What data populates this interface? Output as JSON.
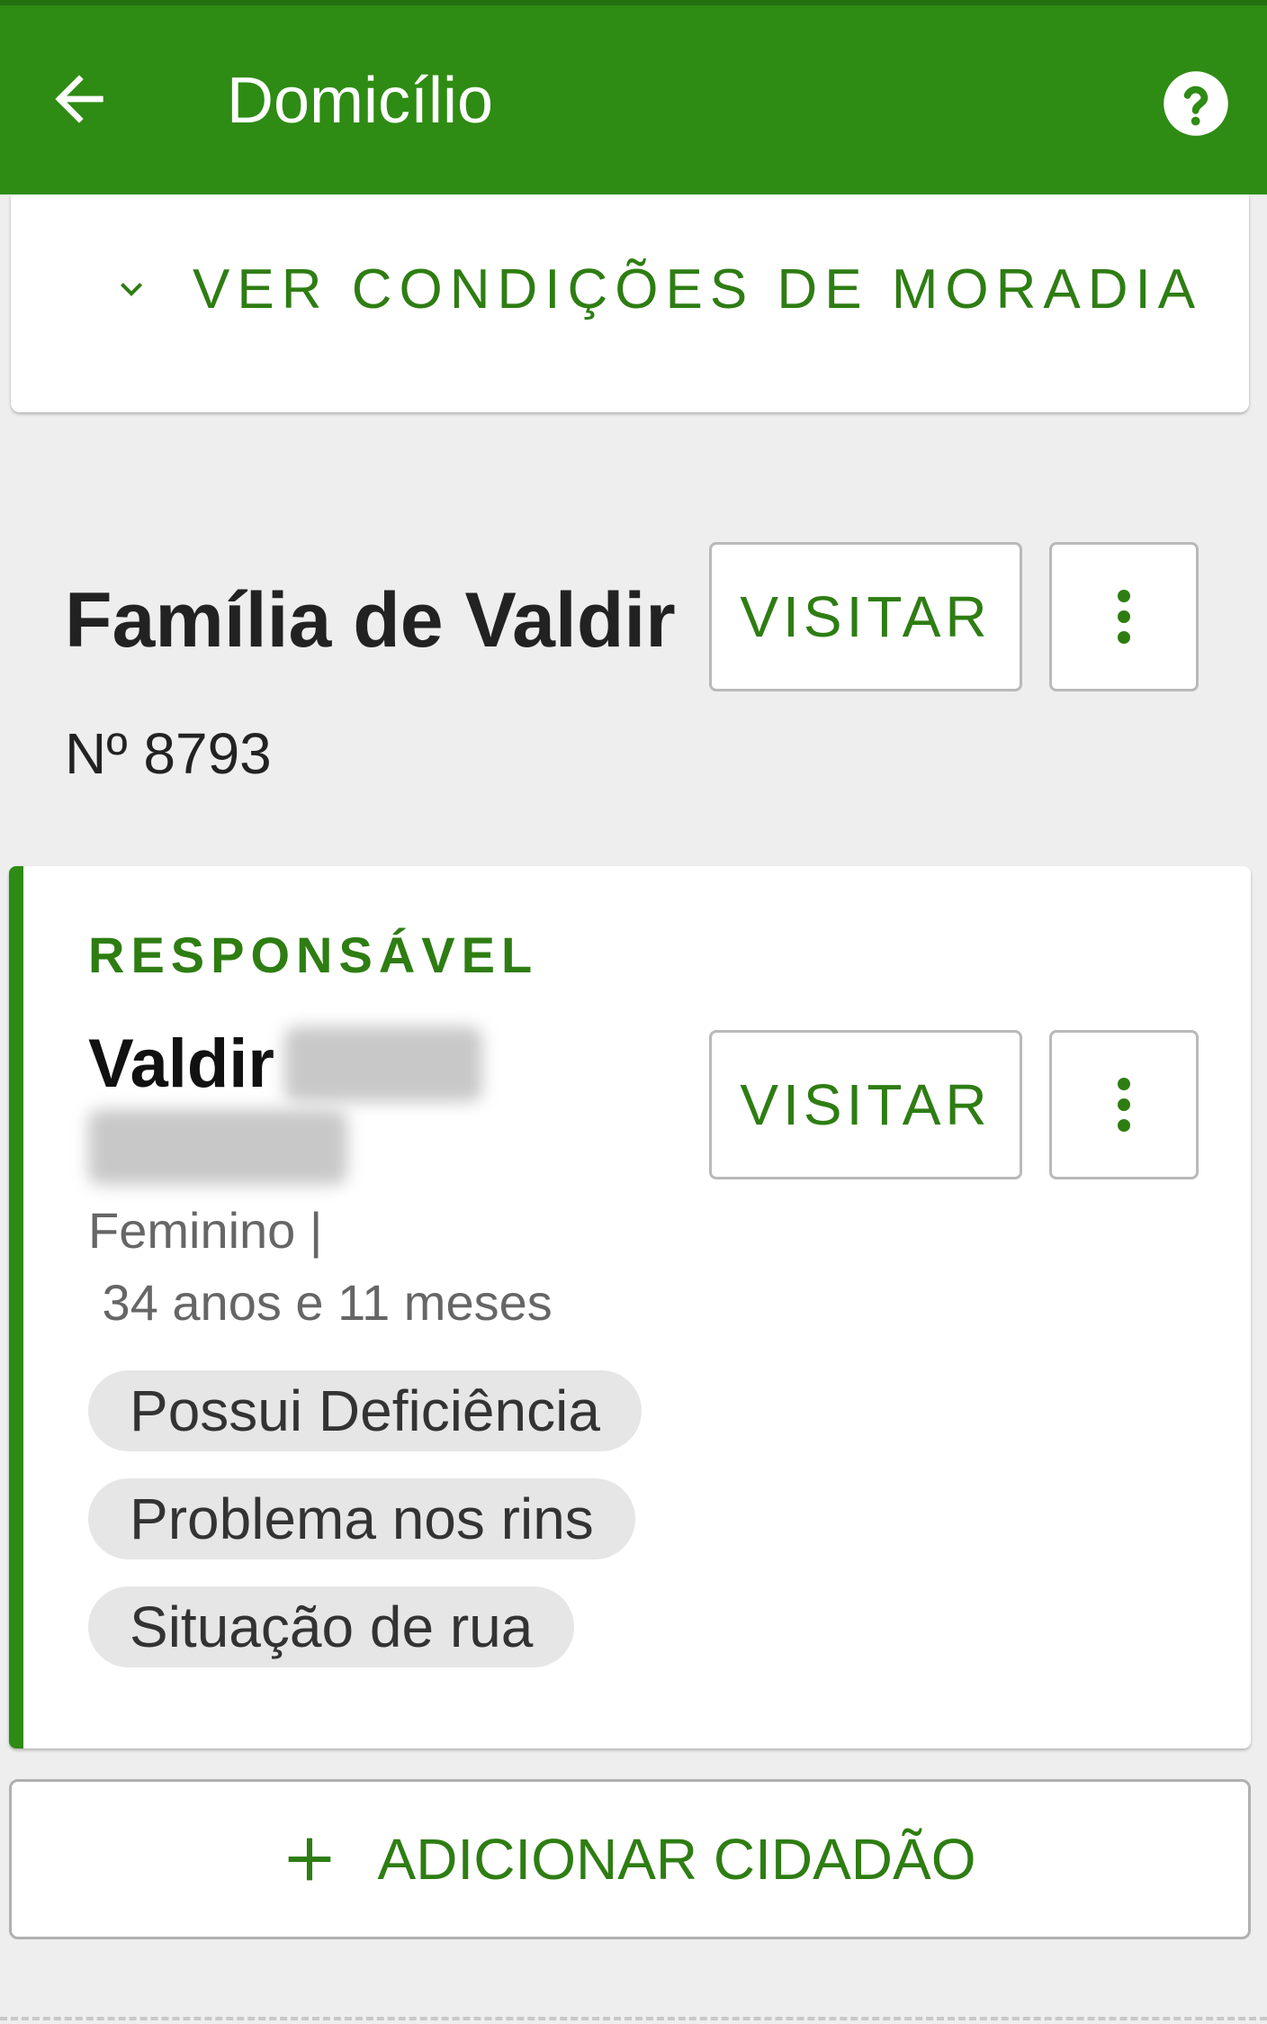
{
  "appbar": {
    "title": "Domicílio",
    "back_icon": "arrow-left-icon",
    "help_icon": "help-circle-icon",
    "color": "#2e8b13"
  },
  "housing": {
    "toggle_label": "VER CONDIÇÕES DE MORADIA",
    "toggle_icon": "chevron-down-icon"
  },
  "family": {
    "title": "Família de Valdir",
    "number": "Nº 8793",
    "visit_label": "VISITAR",
    "more_icon": "more-vertical-icon"
  },
  "responsible": {
    "section_label": "RESPONSÁVEL",
    "first_name": "Valdir",
    "info": "Feminino |\n 34 anos e 11 meses",
    "visit_label": "VISITAR",
    "tags": [
      "Possui Deficiência",
      "Problema nos rins",
      "Situação de rua"
    ]
  },
  "add_citizen": {
    "label": "ADICIONAR CIDADÃO",
    "icon": "plus-icon"
  },
  "colors": {
    "accent": "#2e7d13",
    "background": "#eeeeee",
    "chip": "#e6e6e6"
  }
}
